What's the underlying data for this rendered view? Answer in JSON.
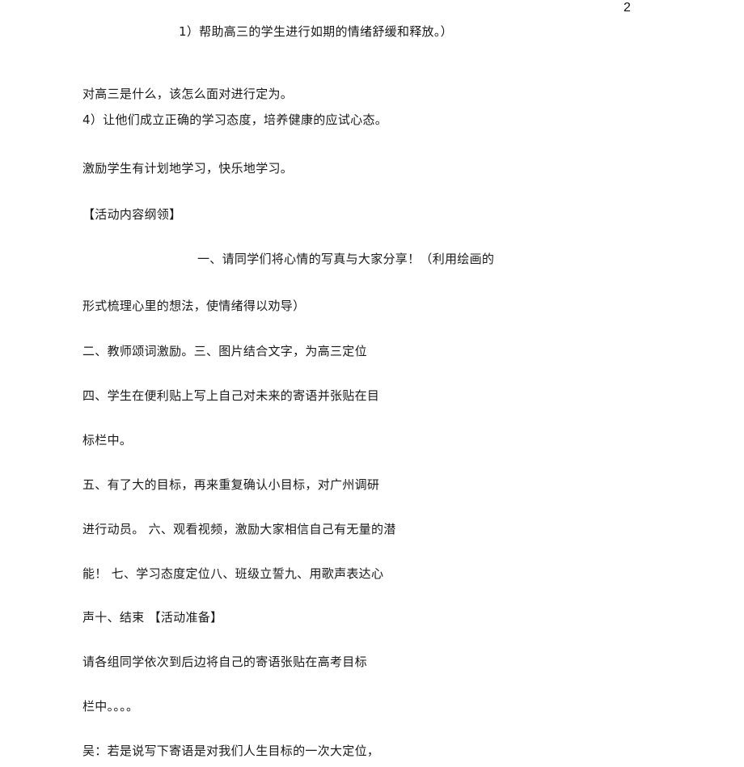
{
  "page": {
    "number": "2"
  },
  "lines": [
    "1）帮助高三的学生进行如期的情绪舒缓和释放。）",
    "对高三是什么，该怎么面对进行定为。",
    "4）让他们成立正确的学习态度，培养健康的应试心态。",
    "激励学生有计划地学习，快乐地学习。",
    "【活动内容纲领】",
    "一、请同学们将心情的写真与大家分享！（利用绘画的",
    "形式梳理心里的想法，使情绪得以劝导）",
    "二、教师颂词激励。三、图片结合文字，为高三定位",
    "四、学生在便利贴上写上自己对未来的寄语并张贴在目",
    "标栏中。",
    "五、有了大的目标，再来重复确认小目标，对广州调研",
    "进行动员。 六、观看视频，激励大家相信自己有无量的潜",
    "能！ 七、学习态度定位八、班级立誓九、用歌声表达心",
    "声十、结束 【活动准备】",
    "请各组同学依次到后边将自己的寄语张贴在高考目标",
    "栏中。。。。",
    "吴：若是说写下寄语是对我们人生目标的一次大定位，"
  ]
}
